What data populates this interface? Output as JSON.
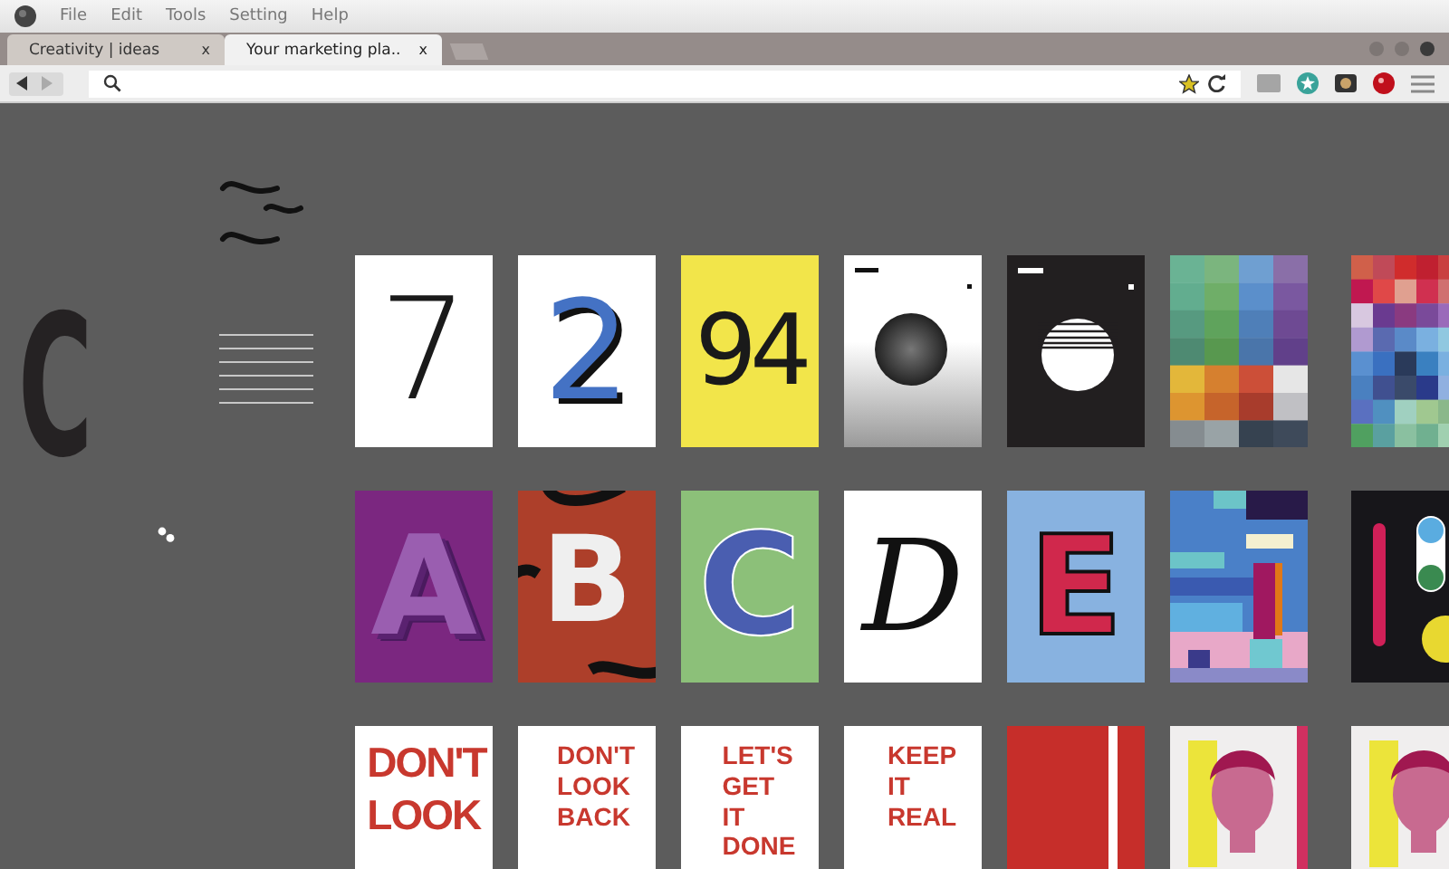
{
  "menu": [
    "File",
    "Edit",
    "Tools",
    "Setting",
    "Help"
  ],
  "tabs": [
    {
      "title": "Creativity  |  ideas",
      "close": "x",
      "selected": false
    },
    {
      "title": "Your marketing pla..",
      "close": "x",
      "selected": true
    }
  ],
  "side": {
    "letter": "C"
  },
  "rows": [
    {
      "posters": [
        {
          "kind": "plain",
          "text": "7"
        },
        {
          "kind": "shadow",
          "text": "2"
        },
        {
          "kind": "yellow",
          "text": "94"
        },
        {
          "kind": "moon"
        },
        {
          "kind": "eclipse"
        },
        {
          "kind": "mosaic"
        },
        {
          "kind": "pixels"
        }
      ]
    },
    {
      "posters": [
        {
          "kind": "relief",
          "text": "A"
        },
        {
          "kind": "wavy",
          "text": "B"
        },
        {
          "kind": "stripes",
          "text": "C"
        },
        {
          "kind": "script",
          "text": "D"
        },
        {
          "kind": "dotted",
          "text": "E"
        },
        {
          "kind": "city"
        },
        {
          "kind": "toggle"
        }
      ]
    },
    {
      "posters": [
        {
          "kind": "slogan",
          "text": "DON'T LOOK",
          "big": true
        },
        {
          "kind": "slogan",
          "text": "DON'T LOOK BACK",
          "big": false
        },
        {
          "kind": "slogan",
          "text": "LET'S GET IT DONE",
          "big": false
        },
        {
          "kind": "slogan",
          "text": "KEEP IT REAL",
          "big": false
        },
        {
          "kind": "band"
        },
        {
          "kind": "picture"
        },
        {
          "kind": "picture"
        }
      ]
    }
  ]
}
